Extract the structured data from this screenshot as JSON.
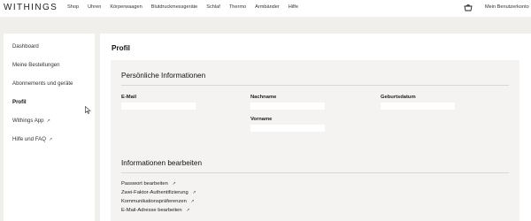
{
  "header": {
    "logo": "WITHINGS",
    "nav": [
      "Shop",
      "Uhren",
      "Körperwaagen",
      "Blutdruckmessgeräte",
      "Schlaf",
      "Thermo",
      "Armbänder",
      "Hilfe"
    ],
    "account_label": "Mein Benutzerkonto",
    "cart_icon": "basket-icon"
  },
  "sidebar": {
    "items": [
      {
        "label": "Dashboard",
        "external": false,
        "active": false
      },
      {
        "label": "Meine Bestellungen",
        "external": false,
        "active": false
      },
      {
        "label": "Abonnements und geräte",
        "external": false,
        "active": false
      },
      {
        "label": "Profil",
        "external": false,
        "active": true
      },
      {
        "label": "Withings App",
        "external": true,
        "active": false
      },
      {
        "label": "Hilfe und FAQ",
        "external": true,
        "active": false
      }
    ],
    "external_arrow": "↗"
  },
  "main": {
    "title": "Profil",
    "personal": {
      "title": "Persönliche Informationen",
      "fields": {
        "email_label": "E-Mail",
        "lastname_label": "Nachname",
        "birthdate_label": "Geburtsdatum",
        "firstname_label": "Vorname"
      }
    },
    "edit": {
      "title": "Informationen bearbeiten",
      "links": [
        "Passwort bearbeiten",
        "Zwei-Faktor-Authentifizierung",
        "Kommunikationspräferenzen",
        "E-Mail-Adresse bearbeiten"
      ]
    }
  },
  "colors": {
    "page_bg": "#f1efec",
    "card_bg": "#f4f3f1",
    "text": "#1a1a1a"
  }
}
